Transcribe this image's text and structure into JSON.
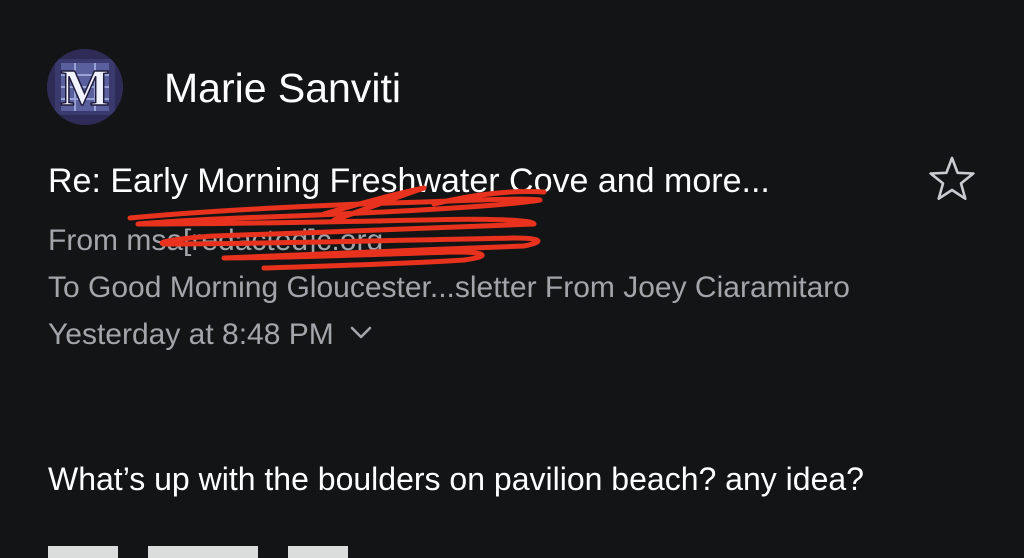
{
  "sender": {
    "avatar_letter": "M",
    "name": "Marie Sanviti"
  },
  "message": {
    "subject": "Re: Early Morning Freshwater Cove and more...",
    "from_label": "From",
    "from_address": "msa[redacted]c.org",
    "to_line": "To Good Morning Gloucester...sletter From Joey Ciaramitaro",
    "date": "Yesterday at 8:48 PM",
    "body": "What’s up with the boulders on pavilion beach? any idea?"
  },
  "icons": {
    "star": "star-outline-icon",
    "expand": "chevron-down-icon"
  },
  "colors": {
    "background": "#121416",
    "primary_text": "#ffffff",
    "secondary_text": "#a2a6aa",
    "redaction": "#e8321e"
  }
}
